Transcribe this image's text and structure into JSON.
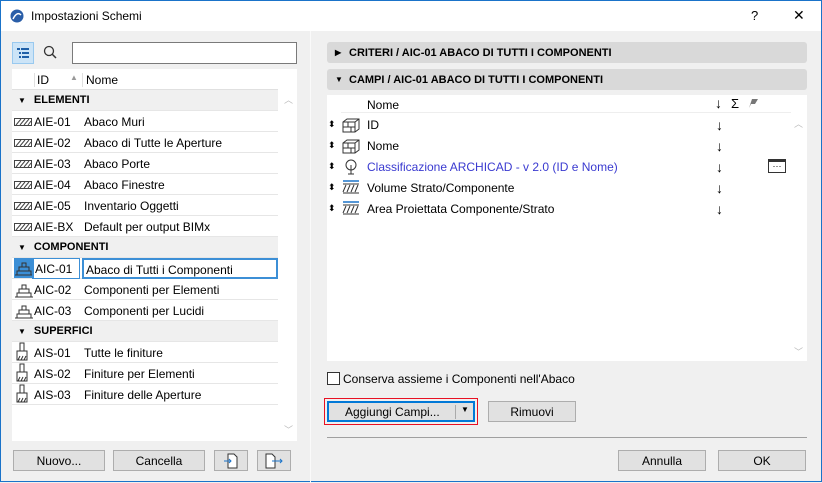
{
  "window": {
    "title": "Impostazioni Schemi",
    "help": "?",
    "close": "✕"
  },
  "left": {
    "search_value": "",
    "columns": {
      "id": "ID",
      "name": "Nome"
    },
    "groups": [
      {
        "label": "ELEMENTI",
        "items": [
          {
            "id": "AIE-01",
            "name": "Abaco Muri"
          },
          {
            "id": "AIE-02",
            "name": "Abaco di Tutte le Aperture"
          },
          {
            "id": "AIE-03",
            "name": "Abaco Porte"
          },
          {
            "id": "AIE-04",
            "name": "Abaco Finestre"
          },
          {
            "id": "AIE-05",
            "name": "Inventario Oggetti"
          },
          {
            "id": "AIE-BX",
            "name": "Default per output BIMx"
          }
        ]
      },
      {
        "label": "COMPONENTI",
        "items": [
          {
            "id": "AIC-01",
            "name": "Abaco di Tutti i Componenti"
          },
          {
            "id": "AIC-02",
            "name": "Componenti per Elementi"
          },
          {
            "id": "AIC-03",
            "name": "Componenti per Lucidi"
          }
        ]
      },
      {
        "label": "SUPERFICI",
        "items": [
          {
            "id": "AIS-01",
            "name": "Tutte le finiture"
          },
          {
            "id": "AIS-02",
            "name": "Finiture per Elementi"
          },
          {
            "id": "AIS-03",
            "name": "Finiture delle Aperture"
          }
        ]
      }
    ],
    "buttons": {
      "new": "Nuovo...",
      "delete": "Cancella"
    }
  },
  "right": {
    "criteria_header": "CRITERI / AIC-01 ABACO DI TUTTI I COMPONENTI",
    "fields_header": "CAMPI / AIC-01 ABACO DI TUTTI I COMPONENTI",
    "fields_columns": {
      "name": "Nome",
      "sort": "↓",
      "sum": "Σ"
    },
    "fields": [
      {
        "name": "ID",
        "sort": "↓"
      },
      {
        "name": "Nome",
        "sort": "↓"
      },
      {
        "name": "Classificazione ARCHICAD - v 2.0 (ID e Nome)",
        "sort": "↓"
      },
      {
        "name": "Volume Strato/Componente",
        "sort": "↓"
      },
      {
        "name": "Area Proiettata Componente/Strato",
        "sort": "↓"
      }
    ],
    "keep_components_label": "Conserva assieme i Componenti nell'Abaco",
    "keep_components_checked": false,
    "add_fields": "Aggiungi Campi...",
    "remove": "Rimuovi",
    "cancel": "Annulla",
    "ok": "OK"
  },
  "colors": {
    "accent": "#0078d7",
    "selection_outline": "#e81123",
    "link": "#3a3ad0"
  }
}
